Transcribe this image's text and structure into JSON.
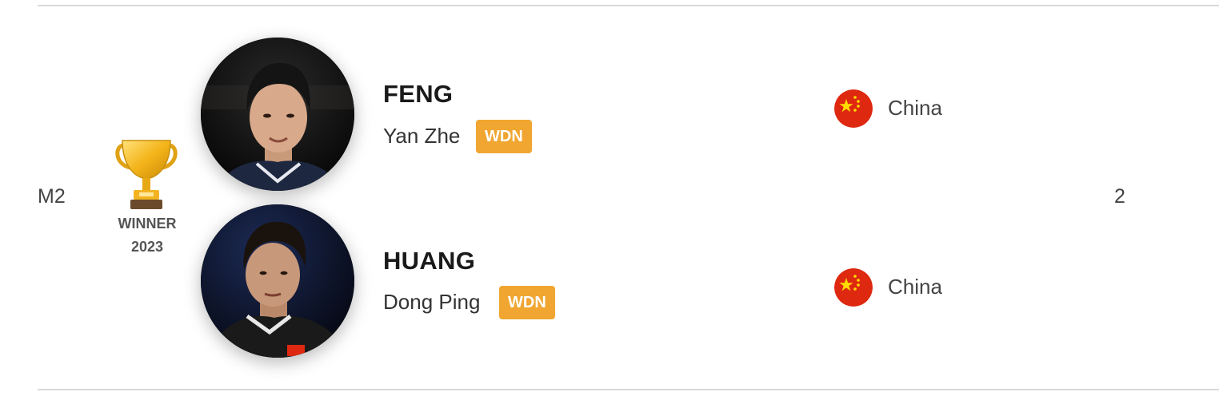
{
  "entry": {
    "seed": "M2",
    "winner": {
      "icon": "trophy-icon",
      "label": "WINNER",
      "year": "2023"
    },
    "score": "2",
    "players": [
      {
        "surname": "FENG",
        "given_name": "Yan Zhe",
        "badge": "WDN",
        "country": "China",
        "flag_icon": "china-flag-icon"
      },
      {
        "surname": "HUANG",
        "given_name": "Dong Ping",
        "badge": "WDN",
        "country": "China",
        "flag_icon": "china-flag-icon"
      }
    ]
  },
  "colors": {
    "badge": "#f0a630",
    "flag_red": "#de2910",
    "flag_star": "#ffde00",
    "divider": "#d9d9d9"
  }
}
